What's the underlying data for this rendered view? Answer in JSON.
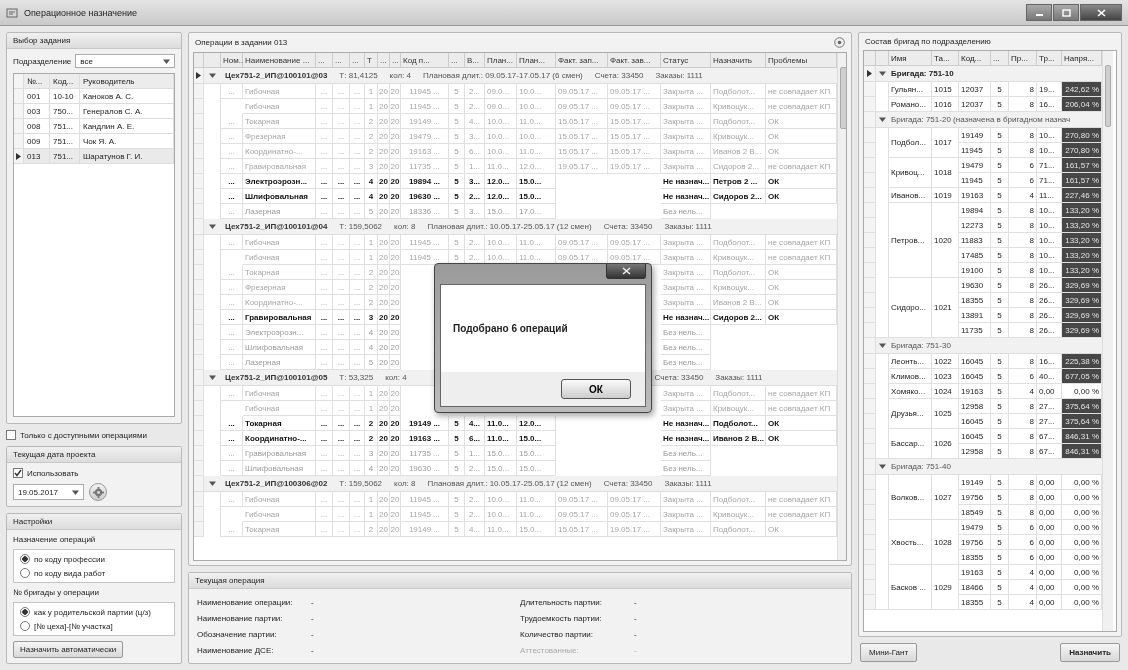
{
  "window": {
    "title": "Операционное назначение"
  },
  "task_panel": {
    "title": "Выбор задания",
    "department_label": "Подразделение",
    "department_value": "все",
    "columns": [
      "№...",
      "Код...",
      "Руководитель"
    ],
    "rows": [
      {
        "num": "001",
        "code": "10-10",
        "lead": "Каноков А. С.",
        "selected": false
      },
      {
        "num": "003",
        "code": "750...",
        "lead": "Генералов С. А.",
        "selected": false
      },
      {
        "num": "008",
        "code": "751...",
        "lead": "Кандлин А. Е.",
        "selected": false
      },
      {
        "num": "009",
        "code": "751...",
        "lead": "Чок Я. А.",
        "selected": false
      },
      {
        "num": "013",
        "code": "751...",
        "lead": "Шаратунов Г. И.",
        "selected": true
      }
    ]
  },
  "only_available": {
    "label": "Только с доступными операциями",
    "checked": false
  },
  "date_panel": {
    "title": "Текущая дата проекта",
    "use": {
      "label": "Использовать",
      "checked": true
    },
    "date": "19.05.2017"
  },
  "settings_panel": {
    "title": "Настройки",
    "groups": [
      {
        "title": "Назначение операций",
        "options": [
          {
            "label": "по коду профессии",
            "selected": true
          },
          {
            "label": "по коду вида работ",
            "selected": false
          }
        ]
      },
      {
        "title": "№ бригады у операции",
        "options": [
          {
            "label": "как у родительской партии (ц/з)",
            "selected": true
          },
          {
            "label": "[№ цеха]-[№ участка]",
            "selected": false
          }
        ]
      }
    ],
    "button": "Назначить автоматически"
  },
  "operations": {
    "title": "Операции в задании 013",
    "columns": [
      "Ном...",
      "Наименование ...",
      "...",
      "...",
      "...",
      "Т",
      "...",
      "...",
      "Код п...",
      "...",
      "В...",
      "План...",
      "План...",
      "Факт. зап...",
      "Факт. зав...",
      "Статус",
      "Назначить",
      "Проблемы"
    ],
    "groups": [
      {
        "current": true,
        "expanded": true,
        "title": "Цех751-2_ИП@100101@03",
        "t": "Т: 81,4125",
        "count": "кол: 4",
        "plan": "Плановая длит.: 09.05.17-17.05.17 (6 смен)",
        "accounts": "Счета: 33450",
        "orders": "Заказы: 1111",
        "rows": [
          {
            "num": "...",
            "name": "Гибочная",
            "kind": "closed",
            "cells": [
              "...",
              "...",
              "...",
              "1",
              "20",
              "20",
              "11945 ...",
              "5",
              "2...",
              "09.0...",
              "10.0...",
              "09.05.17 ...",
              "09.05.17 ...",
              "Закрыта ...",
              "Подболот...",
              "не совпадает КП"
            ]
          },
          {
            "name": "Гибочная",
            "kind": "closed",
            "cells": [
              "...",
              "...",
              "...",
              "1",
              "20",
              "20",
              "11945 ...",
              "5",
              "2...",
              "09.0...",
              "10.0...",
              "09.05.17 ...",
              "09.05.17 ...",
              "Закрыта ...",
              "Кривоцук...",
              "не совпадает КП"
            ]
          },
          {
            "num": "...",
            "name": "Токарная",
            "kind": "closed",
            "cells": [
              "...",
              "...",
              "...",
              "2",
              "20",
              "20",
              "19149 ...",
              "5",
              "4...",
              "10.0...",
              "11.0...",
              "15.05.17 ...",
              "15.05.17 ...",
              "Закрыта ...",
              "Подболот...",
              "ОК"
            ]
          },
          {
            "num": "...",
            "name": "Фрезерная",
            "kind": "closed",
            "cells": [
              "...",
              "...",
              "...",
              "2",
              "20",
              "20",
              "19479 ...",
              "5",
              "3...",
              "10.0...",
              "10.0...",
              "15.05.17 ...",
              "15.05.17 ...",
              "Закрыта ...",
              "Кривоцук...",
              "ОК"
            ]
          },
          {
            "num": "...",
            "name": "Координатно-...",
            "kind": "closed",
            "cells": [
              "...",
              "...",
              "...",
              "2",
              "20",
              "20",
              "19163 ...",
              "5",
              "6...",
              "10.0...",
              "11.0...",
              "15.05.17 ...",
              "15.05.17 ...",
              "Закрыта ...",
              "Иванов 2 В...",
              "ОК"
            ]
          },
          {
            "num": "...",
            "name": "Гравировальная",
            "kind": "closed",
            "cells": [
              "...",
              "...",
              "...",
              "3",
              "20",
              "20",
              "11735 ...",
              "5",
              "1...",
              "11.0...",
              "12.0...",
              "19.05.17 ...",
              "19.05.17 ...",
              "Закрыта ...",
              "Сидоров 2...",
              "не совпадает КП"
            ]
          },
          {
            "num": "...",
            "name": "Электроэрозн...",
            "kind": "pending",
            "cells": [
              "...",
              "...",
              "...",
              "4",
              "20",
              "20",
              "19894 ...",
              "5",
              "3...",
              "12.0...",
              "15.0...",
              null,
              null,
              "Не назнач...",
              "Петров 2 ...",
              "ОК"
            ]
          },
          {
            "num": "...",
            "name": "Шлифовальная",
            "kind": "pending",
            "cells": [
              "...",
              "...",
              "...",
              "4",
              "20",
              "20",
              "19630 ...",
              "5",
              "2...",
              "12.0...",
              "15.0...",
              null,
              null,
              "Не назнач...",
              "Сидоров 2...",
              "ОК"
            ]
          },
          {
            "num": "...",
            "name": "Лазерная",
            "kind": "idle",
            "cells": [
              "...",
              "...",
              "...",
              "5",
              "20",
              "20",
              "18336 ...",
              "5",
              "3...",
              "15.0...",
              "17.0...",
              null,
              null,
              "Без нель...",
              null,
              null
            ]
          }
        ]
      },
      {
        "current": false,
        "expanded": true,
        "title": "Цех751-2_ИП@100101@04",
        "t": "Т: 159,5062",
        "count": "кол: 8",
        "plan": "Плановая длит.: 10.05.17-25.05.17 (12 смен)",
        "accounts": "Счета: 33450",
        "orders": "Заказы: 1111",
        "rows": [
          {
            "num": "...",
            "name": "Гибочная",
            "kind": "closed",
            "cells": [
              "...",
              "...",
              "...",
              "1",
              "20",
              "20",
              "11945 ...",
              "5",
              "2...",
              "10.0...",
              "11.0...",
              "09.05.17 ...",
              "09.05.17 ...",
              "Закрыта ...",
              "Подболот...",
              "не совпадает КП"
            ]
          },
          {
            "name": "Гибочная",
            "kind": "closed",
            "cells": [
              "...",
              "...",
              "...",
              "1",
              "20",
              "20",
              "11945 ...",
              "5",
              "2...",
              "10.0...",
              "11.0...",
              "09.05.17 ...",
              "09.05.17 ...",
              "Закрыта ...",
              "Кривоцук...",
              "не совпадает КП"
            ]
          },
          {
            "num": "...",
            "name": "Токарная",
            "kind": "closed",
            "cells": [
              "...",
              "...",
              "...",
              "2",
              "20",
              "20",
              null,
              null,
              null,
              null,
              null,
              null,
              null,
              "Закрыта ...",
              "Подболот...",
              "ОК"
            ]
          },
          {
            "num": "...",
            "name": "Фрезерная",
            "kind": "closed",
            "cells": [
              "...",
              "...",
              "...",
              "2",
              "20",
              "20",
              null,
              null,
              null,
              null,
              null,
              null,
              null,
              "Закрыта ...",
              "Кривоцук...",
              "ОК"
            ]
          },
          {
            "num": "...",
            "name": "Координатно-...",
            "kind": "closed",
            "cells": [
              "...",
              "...",
              "...",
              "2",
              "20",
              "20",
              null,
              null,
              null,
              null,
              null,
              null,
              null,
              "Закрыта ...",
              "Иванов 2 В...",
              "ОК"
            ]
          },
          {
            "num": "...",
            "name": "Гравировальная",
            "kind": "pending",
            "cells": [
              "...",
              "...",
              "...",
              "3",
              "20",
              "20",
              null,
              null,
              null,
              null,
              null,
              null,
              null,
              "Не назнач...",
              "Сидоров 2...",
              "ОК"
            ]
          },
          {
            "num": "...",
            "name": "Электроэрозн...",
            "kind": "idle",
            "cells": [
              "...",
              "...",
              "...",
              "4",
              "20",
              "20",
              null,
              null,
              null,
              null,
              null,
              null,
              null,
              "Без нель...",
              null,
              null
            ]
          },
          {
            "num": "...",
            "name": "Шлифовальная",
            "kind": "idle",
            "cells": [
              "...",
              "...",
              "...",
              "4",
              "20",
              "20",
              null,
              null,
              null,
              null,
              null,
              null,
              null,
              "Без нель...",
              null,
              null
            ]
          },
          {
            "num": "...",
            "name": "Лазерная",
            "kind": "idle",
            "cells": [
              "...",
              "...",
              "...",
              "5",
              "20",
              "20",
              null,
              null,
              null,
              null,
              null,
              null,
              null,
              "Без нель...",
              null,
              null
            ]
          }
        ]
      },
      {
        "current": false,
        "expanded": true,
        "title": "Цех751-2_ИП@100101@05",
        "t": "Т: 53,325",
        "count": "кол: 4",
        "accounts": "Счета: 33450",
        "orders": "Заказы: 1111",
        "rows": [
          {
            "num": "...",
            "name": "Гибочная",
            "kind": "closed",
            "cells": [
              "...",
              "...",
              "...",
              "1",
              "20",
              "20",
              null,
              null,
              null,
              null,
              null,
              null,
              null,
              "Закрыта ...",
              "Подболот...",
              "не совпадает КП"
            ]
          },
          {
            "name": "Гибочная",
            "kind": "closed",
            "cells": [
              "...",
              "...",
              "...",
              "1",
              "20",
              "20",
              null,
              null,
              null,
              null,
              null,
              null,
              null,
              "Закрыта ...",
              "Кривоцук...",
              "не совпадает КП"
            ]
          },
          {
            "num": "...",
            "name": "Токарная",
            "kind": "pending",
            "cells": [
              "...",
              "...",
              "...",
              "2",
              "20",
              "20",
              "19149 ...",
              "5",
              "4...",
              "11.0...",
              "12.0...",
              null,
              null,
              "Не назнач...",
              "Подболот...",
              "ОК"
            ]
          },
          {
            "num": "...",
            "name": "Координатно-...",
            "kind": "pending",
            "cells": [
              "...",
              "...",
              "...",
              "2",
              "20",
              "20",
              "19163 ...",
              "5",
              "6...",
              "11.0...",
              "15.0...",
              null,
              null,
              "Не назнач...",
              "Иванов 2 В...",
              "ОК"
            ]
          },
          {
            "num": "...",
            "name": "Гравировальная",
            "kind": "idle",
            "cells": [
              "...",
              "...",
              "...",
              "3",
              "20",
              "20",
              "11735 ...",
              "5",
              "1...",
              "15.0...",
              "15.0...",
              null,
              null,
              "Без нель...",
              null,
              null
            ]
          },
          {
            "num": "...",
            "name": "Шлифовальная",
            "kind": "idle",
            "cells": [
              "...",
              "...",
              "...",
              "4",
              "20",
              "20",
              "19630 ...",
              "5",
              "2...",
              "15.0...",
              "15.0...",
              null,
              null,
              "Без нель...",
              null,
              null
            ]
          }
        ]
      },
      {
        "current": false,
        "expanded": true,
        "title": "Цех751-2_ИП@100306@02",
        "t": "Т: 159,5062",
        "count": "кол: 8",
        "plan": "Плановая длит.: 10.05.17-25.05.17 (12 смен)",
        "accounts": "Счета: 33450",
        "orders": "Заказы: 1111",
        "rows": [
          {
            "num": "...",
            "name": "Гибочная",
            "kind": "closed",
            "cells": [
              "...",
              "...",
              "...",
              "1",
              "20",
              "20",
              "11945 ...",
              "5",
              "2...",
              "10.0...",
              "11.0...",
              "09.05.17 ...",
              "09.05.17 ...",
              "Закрыта ...",
              "Подболот...",
              "не совпадает КП"
            ]
          },
          {
            "name": "Гибочная",
            "kind": "closed",
            "cells": [
              "...",
              "...",
              "...",
              "1",
              "20",
              "20",
              "11945 ...",
              "5",
              "2...",
              "10.0...",
              "11.0...",
              "09.05.17 ...",
              "09.05.17 ...",
              "Закрыта ...",
              "Кривоцук...",
              "не совпадает КП"
            ]
          },
          {
            "num": "...",
            "name": "Токарная",
            "kind": "closed",
            "cells": [
              "...",
              "...",
              "...",
              "2",
              "20",
              "20",
              "19149 ...",
              "5",
              "4...",
              "11.0...",
              "15.0...",
              "15.05.17 ...",
              "19.05.17 ...",
              "Закрыта ...",
              "Подболот...",
              "ОК"
            ]
          }
        ]
      }
    ]
  },
  "dialog": {
    "message": "Подобрано 6 операций",
    "button": "ОК"
  },
  "current_operation": {
    "title": "Текущая операция",
    "fields": [
      {
        "label": "Наименование операции:",
        "value": "-",
        "disabled": false
      },
      {
        "label": "Наименование партии:",
        "value": "-",
        "disabled": false
      },
      {
        "label": "Обозначение партии:",
        "value": "-",
        "disabled": false
      },
      {
        "label": "Наименование ДСЕ:",
        "value": "-",
        "disabled": false
      },
      {
        "label": "Длительность партии:",
        "value": "-",
        "disabled": false
      },
      {
        "label": "Трудоемкость партии:",
        "value": "-",
        "disabled": false
      },
      {
        "label": "Количество партии:",
        "value": "-",
        "disabled": false
      },
      {
        "label": "Аттестованные:",
        "value": "-",
        "disabled": true
      }
    ]
  },
  "brigades": {
    "title": "Состав бригад по подразделению",
    "columns": [
      "Имя",
      "Та...",
      "Код...",
      "...",
      "Пр...",
      "Тр...",
      "Напря..."
    ],
    "groups": [
      {
        "title": "Бригада: 751-10",
        "current": true,
        "expanded": true,
        "members": [
          {
            "name": "Гульян...",
            "tab": "1015",
            "lines": [
              {
                "code": "12037",
                "n": "5",
                "pr": "8",
                "tr": "19...",
                "load": "242,62 %",
                "over": true
              }
            ]
          },
          {
            "name": "Романо...",
            "tab": "1016",
            "lines": [
              {
                "code": "12037",
                "n": "5",
                "pr": "8",
                "tr": "16...",
                "load": "206,04 %",
                "over": true
              }
            ]
          }
        ]
      },
      {
        "title": "Бригада: 751-20 (назначена в бригадном назнач",
        "current": false,
        "expanded": true,
        "members": [
          {
            "name": "Подбол...",
            "tab": "1017",
            "lines": [
              {
                "code": "19149",
                "n": "5",
                "pr": "8",
                "tr": "10...",
                "load": "270,80 %",
                "over": true
              },
              {
                "code": "11945",
                "n": "5",
                "pr": "8",
                "tr": "10...",
                "load": "270,80 %",
                "over": true
              }
            ]
          },
          {
            "name": "Кривоц...",
            "tab": "1018",
            "lines": [
              {
                "code": "19479",
                "n": "5",
                "pr": "6",
                "tr": "71...",
                "load": "161,57 %",
                "over": true
              },
              {
                "code": "11945",
                "n": "5",
                "pr": "6",
                "tr": "71...",
                "load": "161,57 %",
                "over": true
              }
            ]
          },
          {
            "name": "Иванов...",
            "tab": "1019",
            "lines": [
              {
                "code": "19163",
                "n": "5",
                "pr": "4",
                "tr": "11...",
                "load": "227,46 %",
                "over": true
              }
            ]
          },
          {
            "name": "Петров...",
            "tab": "1020",
            "lines": [
              {
                "code": "19894",
                "n": "5",
                "pr": "8",
                "tr": "10...",
                "load": "133,20 %",
                "over": true
              },
              {
                "code": "12273",
                "n": "5",
                "pr": "8",
                "tr": "10...",
                "load": "133,20 %",
                "over": true
              },
              {
                "code": "11883",
                "n": "5",
                "pr": "8",
                "tr": "10...",
                "load": "133,20 %",
                "over": true
              },
              {
                "code": "17485",
                "n": "5",
                "pr": "8",
                "tr": "10...",
                "load": "133,20 %",
                "over": true
              },
              {
                "code": "19100",
                "n": "5",
                "pr": "8",
                "tr": "10...",
                "load": "133,20 %",
                "over": true
              }
            ]
          },
          {
            "name": "Сидоро...",
            "tab": "1021",
            "lines": [
              {
                "code": "19630",
                "n": "5",
                "pr": "8",
                "tr": "26...",
                "load": "329,69 %",
                "over": true
              },
              {
                "code": "18355",
                "n": "5",
                "pr": "8",
                "tr": "26...",
                "load": "329,69 %",
                "over": true
              },
              {
                "code": "13891",
                "n": "5",
                "pr": "8",
                "tr": "26...",
                "load": "329,69 %",
                "over": true
              },
              {
                "code": "11735",
                "n": "5",
                "pr": "8",
                "tr": "26...",
                "load": "329,69 %",
                "over": true
              }
            ]
          }
        ]
      },
      {
        "title": "Бригада: 751-30",
        "current": false,
        "expanded": true,
        "members": [
          {
            "name": "Леонть...",
            "tab": "1022",
            "lines": [
              {
                "code": "16045",
                "n": "5",
                "pr": "8",
                "tr": "16...",
                "load": "225,38 %",
                "over": true
              }
            ]
          },
          {
            "name": "Климов...",
            "tab": "1023",
            "lines": [
              {
                "code": "16045",
                "n": "5",
                "pr": "6",
                "tr": "40...",
                "load": "677,05 %",
                "over": true
              }
            ]
          },
          {
            "name": "Хомяко...",
            "tab": "1024",
            "lines": [
              {
                "code": "19163",
                "n": "5",
                "pr": "4",
                "tr": "0,00",
                "load": "0,00 %",
                "over": false
              }
            ]
          },
          {
            "name": "Друзья...",
            "tab": "1025",
            "lines": [
              {
                "code": "12958",
                "n": "5",
                "pr": "8",
                "tr": "27...",
                "load": "375,64 %",
                "over": true
              },
              {
                "code": "16045",
                "n": "5",
                "pr": "8",
                "tr": "27...",
                "load": "375,64 %",
                "over": true
              }
            ]
          },
          {
            "name": "Бассар...",
            "tab": "1026",
            "lines": [
              {
                "code": "16045",
                "n": "5",
                "pr": "8",
                "tr": "67...",
                "load": "846,31 %",
                "over": true
              },
              {
                "code": "12958",
                "n": "5",
                "pr": "8",
                "tr": "67...",
                "load": "846,31 %",
                "over": true
              }
            ]
          }
        ]
      },
      {
        "title": "Бригада: 751-40",
        "current": false,
        "expanded": true,
        "members": [
          {
            "name": "Волков...",
            "tab": "1027",
            "lines": [
              {
                "code": "19149",
                "n": "5",
                "pr": "8",
                "tr": "0,00",
                "load": "0,00 %",
                "over": false
              },
              {
                "code": "19756",
                "n": "5",
                "pr": "8",
                "tr": "0,00",
                "load": "0,00 %",
                "over": false
              },
              {
                "code": "18549",
                "n": "5",
                "pr": "8",
                "tr": "0,00",
                "load": "0,00 %",
                "over": false
              }
            ]
          },
          {
            "name": "Хвость...",
            "tab": "1028",
            "lines": [
              {
                "code": "19479",
                "n": "5",
                "pr": "6",
                "tr": "0,00",
                "load": "0,00 %",
                "over": false
              },
              {
                "code": "19756",
                "n": "5",
                "pr": "6",
                "tr": "0,00",
                "load": "0,00 %",
                "over": false
              },
              {
                "code": "18355",
                "n": "5",
                "pr": "6",
                "tr": "0,00",
                "load": "0,00 %",
                "over": false
              }
            ]
          },
          {
            "name": "Басков ...",
            "tab": "1029",
            "lines": [
              {
                "code": "19163",
                "n": "5",
                "pr": "4",
                "tr": "0,00",
                "load": "0,00 %",
                "over": false
              },
              {
                "code": "18466",
                "n": "5",
                "pr": "4",
                "tr": "0,00",
                "load": "0,00 %",
                "over": false
              },
              {
                "code": "18355",
                "n": "5",
                "pr": "4",
                "tr": "0,00",
                "load": "0,00 %",
                "over": false
              }
            ]
          }
        ]
      }
    ]
  },
  "buttons": {
    "gantt": "Мини-Гант",
    "assign": "Назначить"
  }
}
